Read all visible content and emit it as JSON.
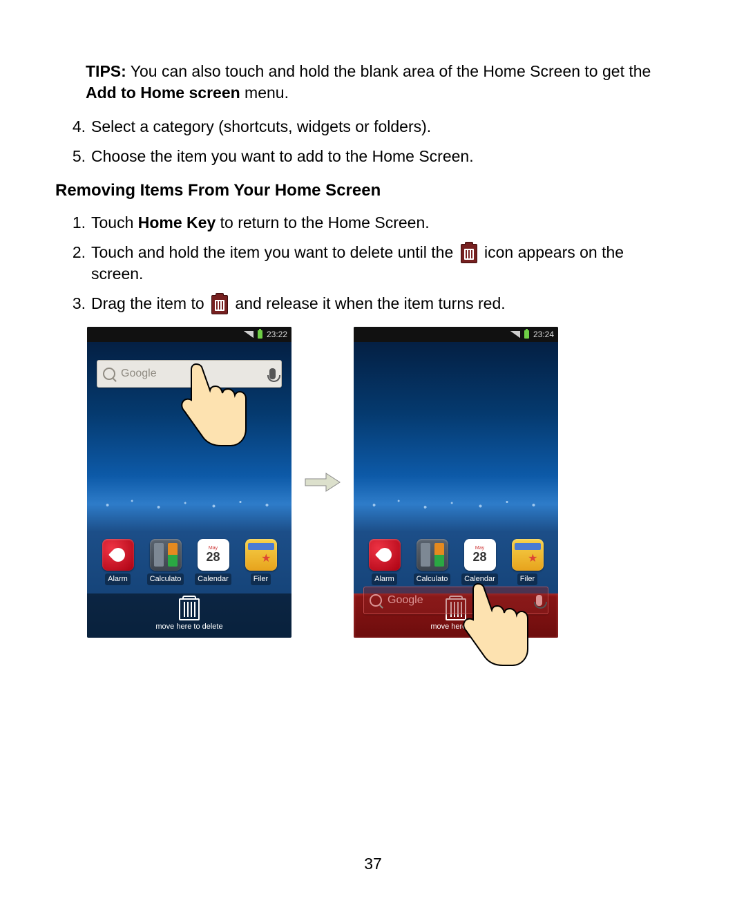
{
  "tips": {
    "label": "TIPS:",
    "text_before_bold": " You can also touch and hold the blank area of the Home Screen to get the ",
    "bold": "Add to Home screen",
    "text_after_bold": " menu."
  },
  "top_steps": [
    {
      "n": "4.",
      "text": "Select a category (shortcuts, widgets or folders)."
    },
    {
      "n": "5.",
      "text": "Choose the item you want to add to the Home Screen."
    }
  ],
  "heading": "Removing Items From Your Home Screen",
  "remove_steps": {
    "s1": {
      "n": "1.",
      "before": "Touch ",
      "bold": "Home Key",
      "after": " to return to the Home Screen."
    },
    "s2": {
      "n": "2.",
      "before": "Touch and hold the item you want to delete until the ",
      "after": " icon appears on the screen."
    },
    "s3": {
      "n": "3.",
      "before": "Drag the item to ",
      "after": " and release it when the item turns red."
    }
  },
  "phone": {
    "time1": "23:22",
    "time2": "23:24",
    "search_placeholder": "Google",
    "apps": [
      {
        "label": "Alarm"
      },
      {
        "label": "Calculato"
      },
      {
        "label": "Calendar",
        "month": "May",
        "day": "28"
      },
      {
        "label": "Filer"
      }
    ],
    "delete_label_full": "move here to delete",
    "delete_label_cut": "move here to d"
  },
  "page_number": "37"
}
